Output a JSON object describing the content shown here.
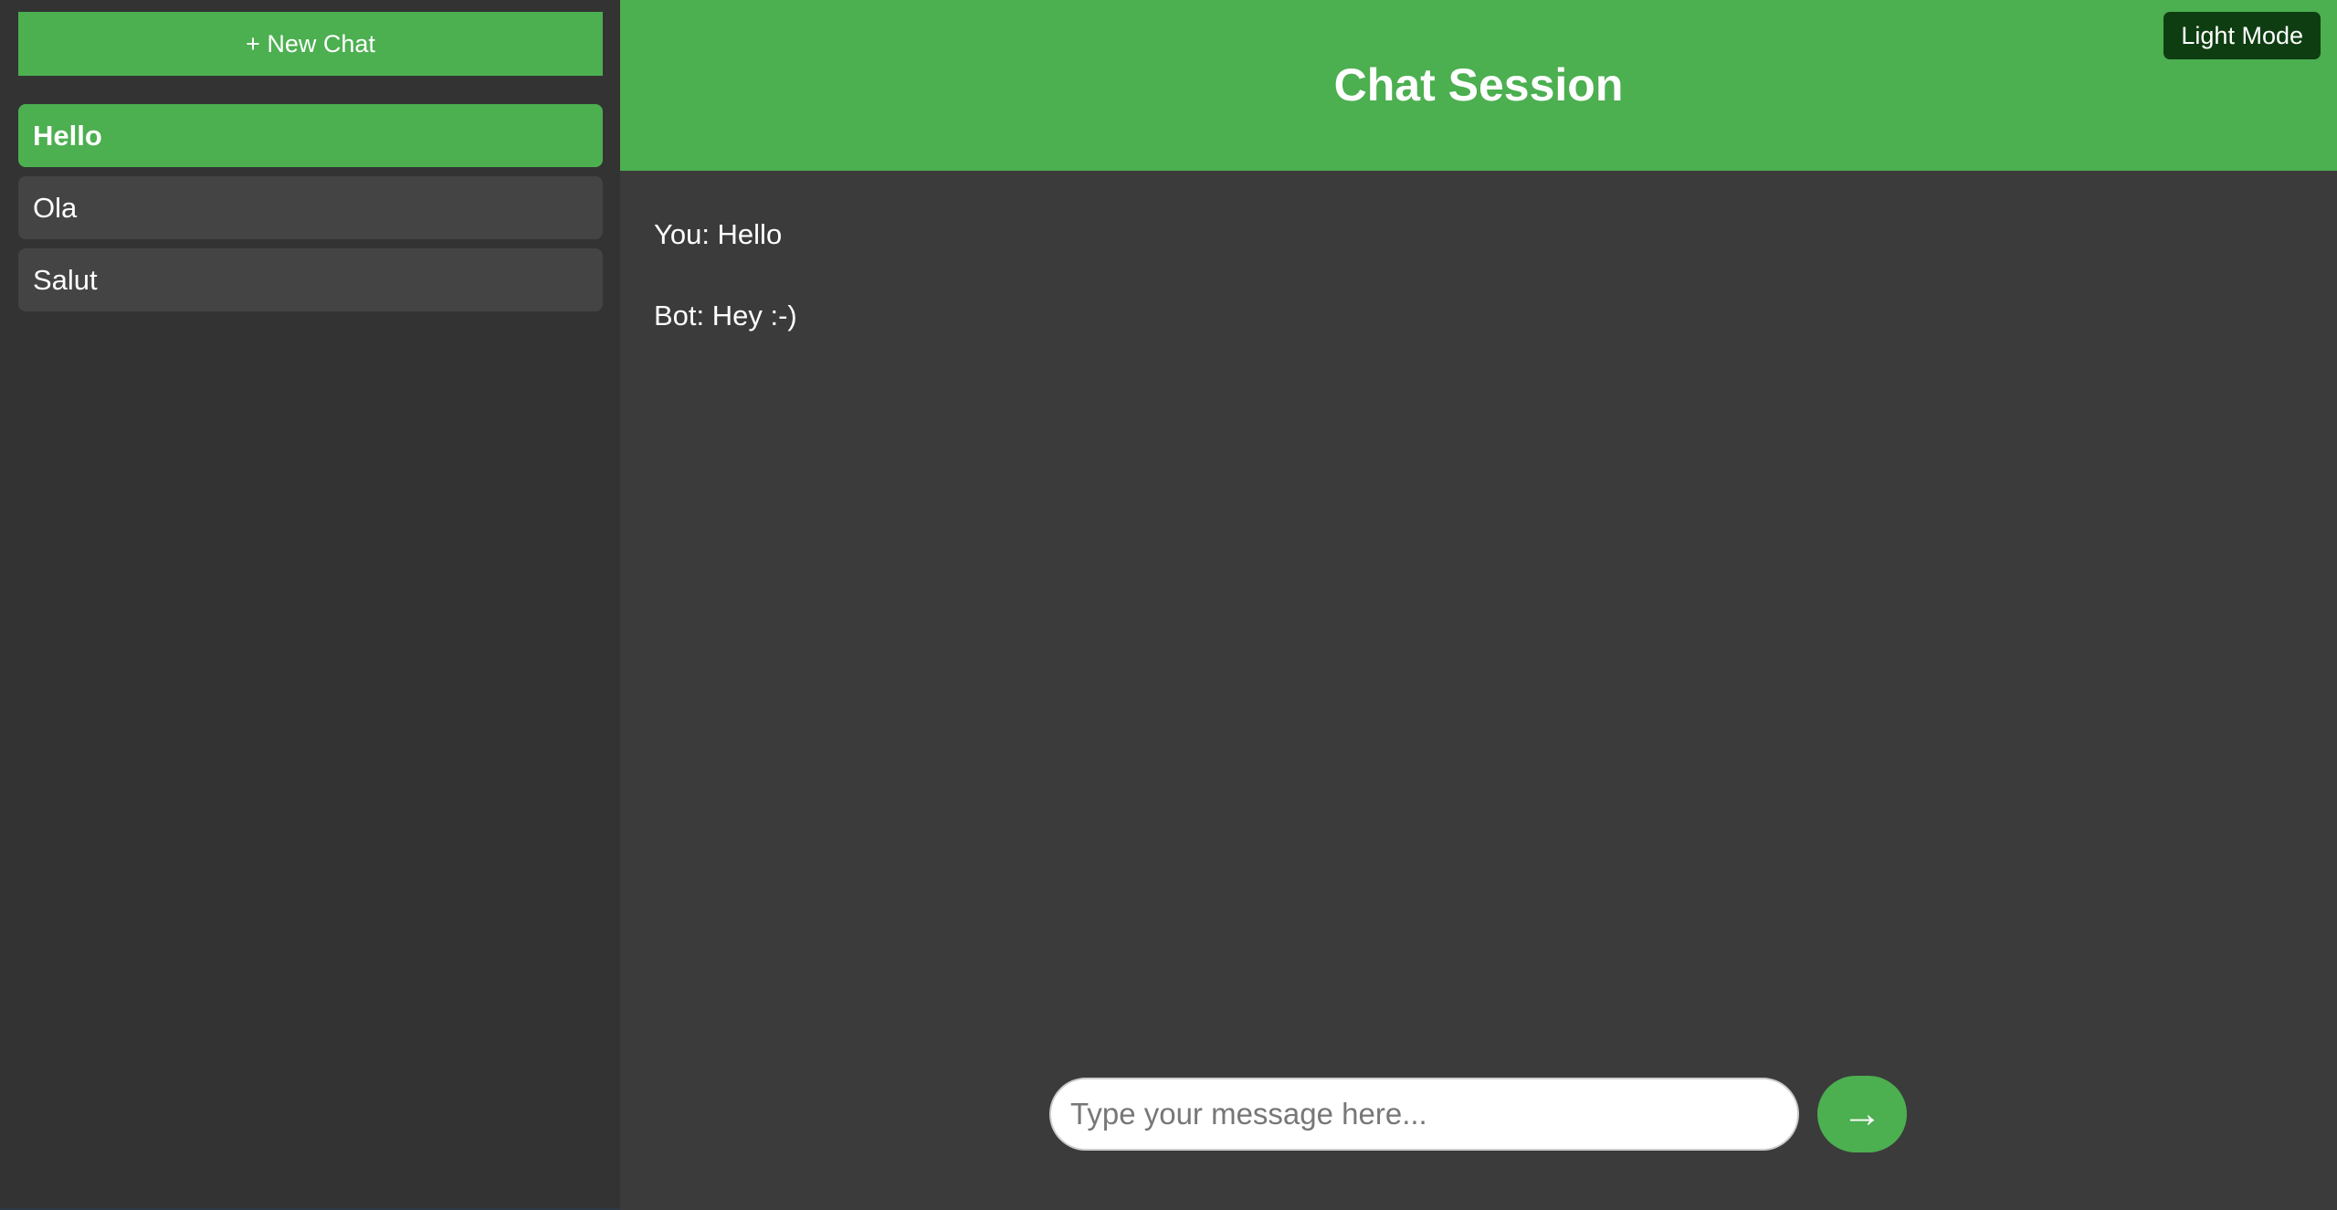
{
  "sidebar": {
    "new_chat_label": "+ New Chat",
    "chats": [
      {
        "label": "Hello",
        "active": true
      },
      {
        "label": "Ola",
        "active": false
      },
      {
        "label": "Salut",
        "active": false
      }
    ]
  },
  "header": {
    "title": "Chat Session",
    "mode_toggle_label": "Light Mode"
  },
  "messages": [
    {
      "text": "You: Hello"
    },
    {
      "text": "Bot: Hey :-)"
    }
  ],
  "composer": {
    "placeholder": "Type your message here...",
    "value": "",
    "send_icon": "→"
  },
  "colors": {
    "accent": "#4caf50",
    "sidebar_bg": "#333333",
    "main_bg": "#3b3b3b",
    "toggle_bg": "#0f3d12"
  }
}
